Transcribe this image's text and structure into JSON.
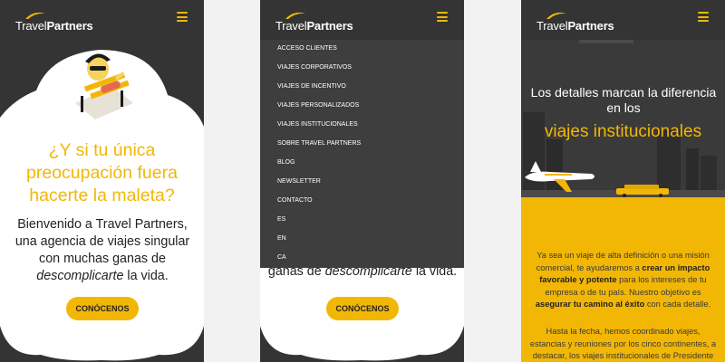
{
  "brand": {
    "name_light": "Travel",
    "name_bold": "Partners"
  },
  "colors": {
    "accent": "#f2b705",
    "dark": "#343434",
    "menu_bg": "#3e3e3e"
  },
  "hero": {
    "title": "¿Y si tu única preocupación fuera hacerte la maleta?",
    "text_before": "Bienvenido a Travel Partners, una agencia de viajes singular con muchas ganas de ",
    "text_em": "descomplicarte",
    "text_after": " la vida.",
    "cta_label": "CONÓCENOS"
  },
  "screen2": {
    "text_em": "descomplicarte",
    "text_before": "ganas de ",
    "text_after": " la vida.",
    "cta_label": "CONÓCENOS"
  },
  "menu": {
    "items": [
      "ACCESO CLIENTES",
      "VIAJES CORPORATIVOS",
      "VIAJES DE INCENTIVO",
      "VIAJES PERSONALIZADOS",
      "VIAJES INSTITUCIONALES",
      "SOBRE TRAVEL PARTNERS",
      "BLOG",
      "NEWSLETTER",
      "CONTACTO",
      "ES",
      "EN",
      "CA"
    ]
  },
  "institutional": {
    "heading": "Los detalles marcan la diferencia en los",
    "highlight": "viajes institucionales",
    "p1_a": "Ya sea un viaje de alta definición o una misión comercial, te ayudaremos a ",
    "p1_b": "crear un impacto favorable y potente",
    "p1_c": " para los intereses de tu empresa o de tu país. Nuestro objetivo es ",
    "p1_d": "asegurar tu camino al éxito",
    "p1_e": " con cada detalle.",
    "p2": "Hasta la fecha, hemos coordinado viajes, estancias y reuniones por los cinco continentes, a destacar, los viajes institucionales de Presidente y..."
  }
}
